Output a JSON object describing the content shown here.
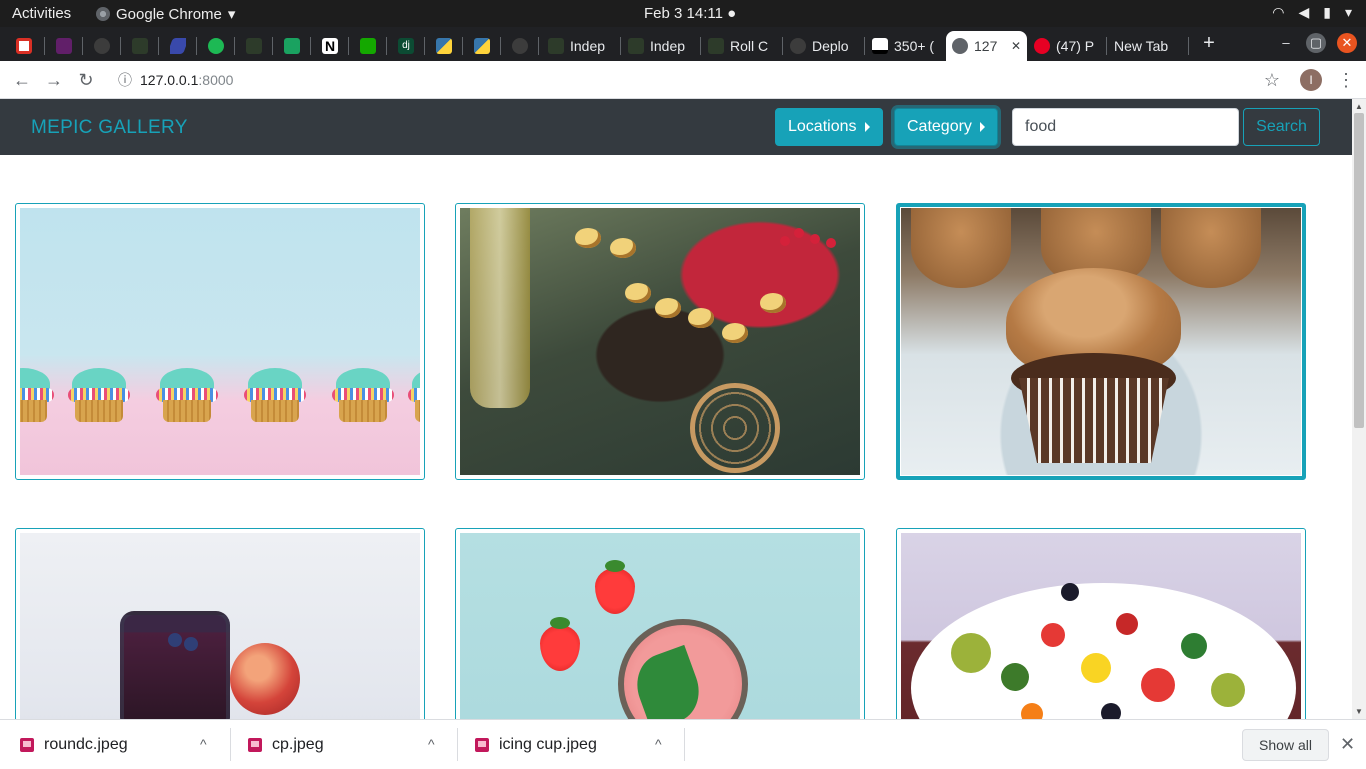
{
  "system": {
    "activities": "Activities",
    "app_name": "Google Chrome",
    "app_menu_caret": "▾",
    "clock": "Feb 3  14:11 ●",
    "tray": [
      "wifi-icon",
      "volume-icon",
      "battery-icon",
      "power-menu-icon"
    ]
  },
  "tabs": [
    {
      "label": "",
      "icon": "gmail-icon"
    },
    {
      "label": "",
      "icon": "slack-icon"
    },
    {
      "label": "",
      "icon": "github-icon"
    },
    {
      "label": "",
      "icon": "tree-icon"
    },
    {
      "label": "",
      "icon": "pen-icon"
    },
    {
      "label": "",
      "icon": "green-check-icon"
    },
    {
      "label": "",
      "icon": "tree-icon"
    },
    {
      "label": "",
      "icon": "cross-icon"
    },
    {
      "label": "",
      "icon": "notion-icon"
    },
    {
      "label": "",
      "icon": "upwork-icon"
    },
    {
      "label": "",
      "icon": "django-icon"
    },
    {
      "label": "",
      "icon": "python-icon"
    },
    {
      "label": "",
      "icon": "python-icon"
    },
    {
      "label": "",
      "icon": "github-icon"
    },
    {
      "label": "Indep",
      "icon": "tree-icon"
    },
    {
      "label": "Indep",
      "icon": "tree-icon"
    },
    {
      "label": "Roll C",
      "icon": "tree-icon"
    },
    {
      "label": "Deplo",
      "icon": "github-icon"
    },
    {
      "label": "350+ (",
      "icon": "bank-icon"
    },
    {
      "label": "127",
      "icon": "globe-icon",
      "active": true
    },
    {
      "label": "(47) P",
      "icon": "pinterest-icon"
    },
    {
      "label": "New Tab",
      "icon": ""
    }
  ],
  "tab_close": "✕",
  "new_tab": "+",
  "window_controls": {
    "minimize": "–",
    "maximize": "▢",
    "close": "✕"
  },
  "browser": {
    "back": "←",
    "forward": "→",
    "reload": "↻",
    "info_icon": "ⓘ",
    "url_host": "127.0.0.1",
    "url_port": ":8000",
    "bookmark": "☆",
    "profile_initial": "I",
    "menu": "⋮"
  },
  "navbar": {
    "brand": "MEPIC GALLERY",
    "locations_label": "Locations",
    "category_label": "Category",
    "search_value": "food",
    "search_button": "Search"
  },
  "gallery": {
    "images": [
      {
        "subject": "cupcakes"
      },
      {
        "subject": "cake"
      },
      {
        "subject": "chocolate cupcake",
        "selected": true
      },
      {
        "subject": "smoothie"
      },
      {
        "subject": "strawberry"
      },
      {
        "subject": "salad"
      }
    ]
  },
  "downloads": {
    "files": [
      "roundc.jpeg",
      "cp.jpeg",
      "icing cup.jpeg"
    ],
    "caret": "^",
    "show_all": "Show all",
    "close": "✕"
  },
  "colors": {
    "accent": "#17a2b8",
    "navbar_bg": "#343a40",
    "tabstrip_bg": "#202124"
  }
}
